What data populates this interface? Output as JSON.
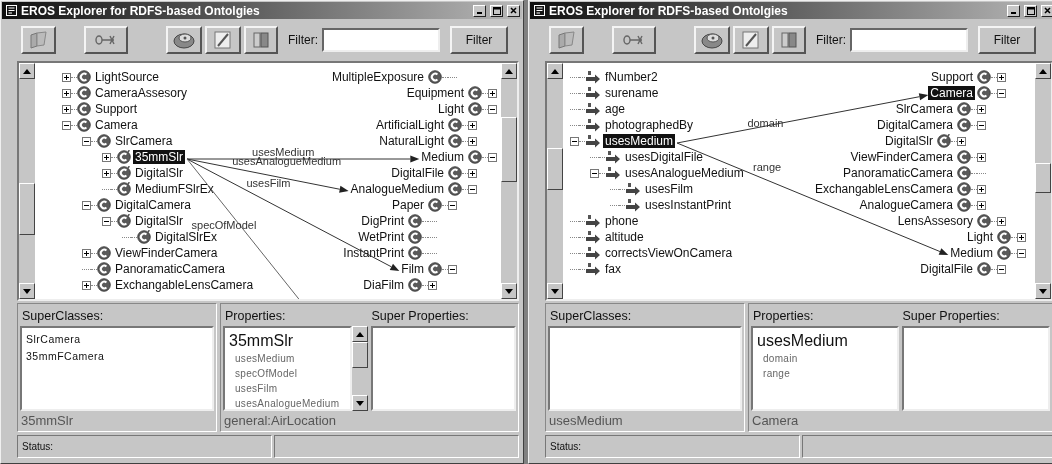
{
  "windows": [
    {
      "title": "EROS Explorer for RDFS-based Ontolgies",
      "toolbar": {
        "filter_label": "Filter:",
        "filter_button": "Filter"
      },
      "canvas": {
        "left_tree": [
          {
            "children": [
              {
                "label": "LightSource",
                "kind": "class",
                "expanded": false,
                "selected": false
              },
              {
                "label": "CameraAssesory",
                "kind": "class",
                "expanded": false,
                "selected": false
              },
              {
                "label": "Support",
                "kind": "class",
                "expanded": false,
                "selected": false
              },
              {
                "label": "Camera",
                "kind": "class",
                "expanded": true,
                "selected": false,
                "children": [
                  {
                    "label": "SlrCamera",
                    "kind": "class",
                    "expanded": true,
                    "selected": false,
                    "children": [
                      {
                        "label": "35mmSlr",
                        "kind": "multi",
                        "expanded": false,
                        "selected": true
                      },
                      {
                        "label": "DigitalSlr",
                        "kind": "multi",
                        "expanded": false,
                        "selected": false
                      },
                      {
                        "label": "MediumFSlrEx",
                        "kind": "multi",
                        "selected": false
                      }
                    ]
                  },
                  {
                    "label": "DigitalCamera",
                    "kind": "class",
                    "expanded": true,
                    "selected": false,
                    "children": [
                      {
                        "label": "DigitalSlr",
                        "kind": "multi",
                        "expanded": true,
                        "selected": false,
                        "children": [
                          {
                            "label": "DigitalSlrEx",
                            "kind": "multi",
                            "selected": false
                          }
                        ]
                      }
                    ]
                  },
                  {
                    "label": "ViewFinderCamera",
                    "kind": "class",
                    "expanded": false,
                    "selected": false
                  },
                  {
                    "label": "PanoramaticCamera",
                    "kind": "class",
                    "selected": false
                  },
                  {
                    "label": "ExchangableLensCamera",
                    "kind": "class",
                    "expanded": false,
                    "selected": false
                  }
                ]
              }
            ]
          }
        ],
        "right_tree": [
          {
            "children": [
              {
                "children": [
                  {
                    "label": "MultipleExposure",
                    "kind": "class",
                    "selected": false
                  }
                ]
              }
            ]
          },
          {
            "label": "Equipment",
            "kind": "class",
            "expanded": false,
            "selected": false
          },
          {
            "label": "Light",
            "kind": "class",
            "expanded": true,
            "selected": false,
            "children": [
              {
                "label": "ArtificialLight",
                "kind": "class",
                "expanded": false,
                "selected": false
              },
              {
                "label": "NaturalLight",
                "kind": "class",
                "expanded": false,
                "selected": false
              }
            ]
          },
          {
            "label": "Medium",
            "kind": "class",
            "expanded": true,
            "selected": false,
            "edge": "usesMedium",
            "children": [
              {
                "label": "DigitalFile",
                "kind": "class",
                "expanded": false,
                "selected": false
              },
              {
                "label": "AnalogueMedium",
                "kind": "class",
                "expanded": true,
                "selected": false,
                "edge": "usesAnalogueMedium",
                "children": [
                  {
                    "label": "Paper",
                    "kind": "class",
                    "expanded": true,
                    "selected": false,
                    "children": [
                      {
                        "label": "DigPrint",
                        "kind": "class",
                        "selected": false
                      },
                      {
                        "label": "WetPrint",
                        "kind": "class",
                        "selected": false
                      },
                      {
                        "label": "InstantPrint",
                        "kind": "class",
                        "selected": false
                      }
                    ]
                  },
                  {
                    "label": "Film",
                    "kind": "class",
                    "expanded": true,
                    "selected": false,
                    "edge": "usesFilm",
                    "children": [
                      {
                        "label": "DiaFilm",
                        "kind": "class",
                        "expanded": false,
                        "selected": false
                      }
                    ]
                  }
                ]
              }
            ]
          }
        ],
        "offscreen_edges": [
          "specOfModel"
        ]
      },
      "superclasses": {
        "header": "SuperClasses:",
        "items": [
          "SlrCamera",
          "35mmFCamera"
        ],
        "footer": "35mmSlr"
      },
      "properties": {
        "header": "Properties:",
        "super_header": "Super Properties:",
        "title": "35mmSlr",
        "items": [
          "usesMedium",
          "specOfModel",
          "usesFilm",
          "usesAnalogueMedium"
        ],
        "scrollbar": true,
        "footer": "general:AirLocation"
      },
      "status": {
        "label": "Status:"
      }
    },
    {
      "title": "EROS Explorer for RDFS-based Ontolgies",
      "toolbar": {
        "filter_label": "Filter:",
        "filter_button": "Filter"
      },
      "canvas": {
        "left_tree": [
          {
            "label": "fNumber2",
            "kind": "property",
            "selected": false
          },
          {
            "label": "surename",
            "kind": "property",
            "selected": false
          },
          {
            "label": "age",
            "kind": "property",
            "selected": false
          },
          {
            "label": "photographedBy",
            "kind": "property",
            "selected": false
          },
          {
            "label": "usesMedium",
            "kind": "property",
            "expanded": true,
            "selected": true,
            "children": [
              {
                "label": "usesDigitalFile",
                "kind": "property",
                "selected": false
              },
              {
                "label": "usesAnalogueMedium",
                "kind": "property",
                "expanded": true,
                "selected": false,
                "children": [
                  {
                    "label": "usesFilm",
                    "kind": "property",
                    "selected": false
                  },
                  {
                    "label": "usesInstantPrint",
                    "kind": "property",
                    "selected": false
                  }
                ]
              }
            ]
          },
          {
            "label": "phone",
            "kind": "property",
            "selected": false
          },
          {
            "label": "altitude",
            "kind": "property",
            "selected": false
          },
          {
            "label": "correctsViewOnCamera",
            "kind": "property",
            "selected": false
          },
          {
            "label": "fax",
            "kind": "property",
            "selected": false
          }
        ],
        "right_tree": [
          {
            "children": [
              {
                "label": "Support",
                "kind": "class",
                "expanded": false,
                "selected": false
              },
              {
                "label": "Camera",
                "kind": "class",
                "expanded": true,
                "selected": true,
                "edge": "domain",
                "children": [
                  {
                    "label": "SlrCamera",
                    "kind": "class",
                    "expanded": false,
                    "selected": false
                  },
                  {
                    "label": "DigitalCamera",
                    "kind": "class",
                    "expanded": true,
                    "selected": false,
                    "children": [
                      {
                        "label": "DigitalSlr",
                        "kind": "multi",
                        "expanded": false,
                        "selected": false
                      }
                    ]
                  },
                  {
                    "label": "ViewFinderCamera",
                    "kind": "class",
                    "expanded": false,
                    "selected": false
                  },
                  {
                    "label": "PanoramaticCamera",
                    "kind": "class",
                    "selected": false
                  },
                  {
                    "label": "ExchangableLensCamera",
                    "kind": "class",
                    "expanded": false,
                    "selected": false
                  },
                  {
                    "label": "AnalogueCamera",
                    "kind": "class",
                    "expanded": false,
                    "selected": false
                  }
                ]
              },
              {
                "label": "LensAssesory",
                "kind": "class",
                "expanded": false,
                "selected": false
              }
            ]
          },
          {
            "label": "Light",
            "kind": "class",
            "expanded": false,
            "selected": false
          },
          {
            "label": "Medium",
            "kind": "class",
            "expanded": true,
            "selected": false,
            "edge": "range",
            "children": [
              {
                "label": "DigitalFile",
                "kind": "class",
                "expanded": true,
                "selected": false
              }
            ]
          }
        ]
      },
      "superclasses": {
        "header": "SuperClasses:",
        "footer": "usesMedium"
      },
      "properties": {
        "header": "Properties:",
        "super_header": "Super Properties:",
        "title": "usesMedium",
        "items": [
          "domain",
          "range"
        ],
        "scrollbar": false,
        "footer": "Camera"
      },
      "status": {
        "label": "Status:"
      }
    }
  ]
}
